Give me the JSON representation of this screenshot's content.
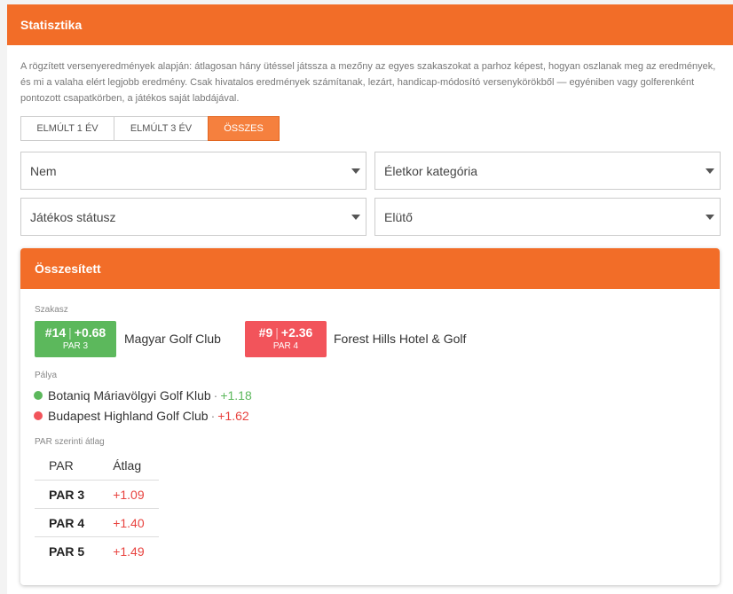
{
  "panel": {
    "title": "Statisztika",
    "description": "A rögzített versenyeredmények alapján: átlagosan hány ütéssel játssza a mezőny az egyes szakaszokat a parhoz képest, hogyan oszlanak meg az eredmények, és mi a valaha elért legjobb eredmény. Csak hivatalos eredmények számítanak, lezárt, handicap-módosító versenykörökből — egyéniben vagy golferenként pontozott csapatkörben, a játékos saját labdájával."
  },
  "periods": [
    {
      "label": "ELMÚLT 1 ÉV",
      "active": false
    },
    {
      "label": "ELMÚLT 3 ÉV",
      "active": false
    },
    {
      "label": "ÖSSZES",
      "active": true
    }
  ],
  "filters": {
    "gender": "Nem",
    "age": "Életkor kategória",
    "status": "Játékos státusz",
    "tee": "Elütő"
  },
  "summary": {
    "title": "Összesített",
    "hole_section_label": "Szakasz",
    "holes": [
      {
        "rank": "#14",
        "diff": "+0.68",
        "par": "PAR 3",
        "club": "Magyar Golf Club",
        "color": "#5cb85c"
      },
      {
        "rank": "#9",
        "diff": "+2.36",
        "par": "PAR 4",
        "club": "Forest Hills Hotel & Golf",
        "color": "#f2545b"
      }
    ],
    "course_section_label": "Pálya",
    "courses": [
      {
        "name": "Botaniq Máriavölgyi Golf Klub",
        "value": "+1.18",
        "color": "#5cb85c"
      },
      {
        "name": "Budapest Highland Golf Club",
        "value": "+1.62",
        "color": "#f2545b"
      }
    ],
    "par_section_label": "PAR szerinti átlag",
    "par_table": {
      "headers": [
        "PAR",
        "Átlag"
      ],
      "rows": [
        {
          "par": "PAR 3",
          "avg": "+1.09"
        },
        {
          "par": "PAR 4",
          "avg": "+1.40"
        },
        {
          "par": "PAR 5",
          "avg": "+1.49"
        }
      ]
    }
  },
  "colors": {
    "accent": "#f26d28",
    "positive": "#5cb85c",
    "negative": "#f2545b"
  }
}
